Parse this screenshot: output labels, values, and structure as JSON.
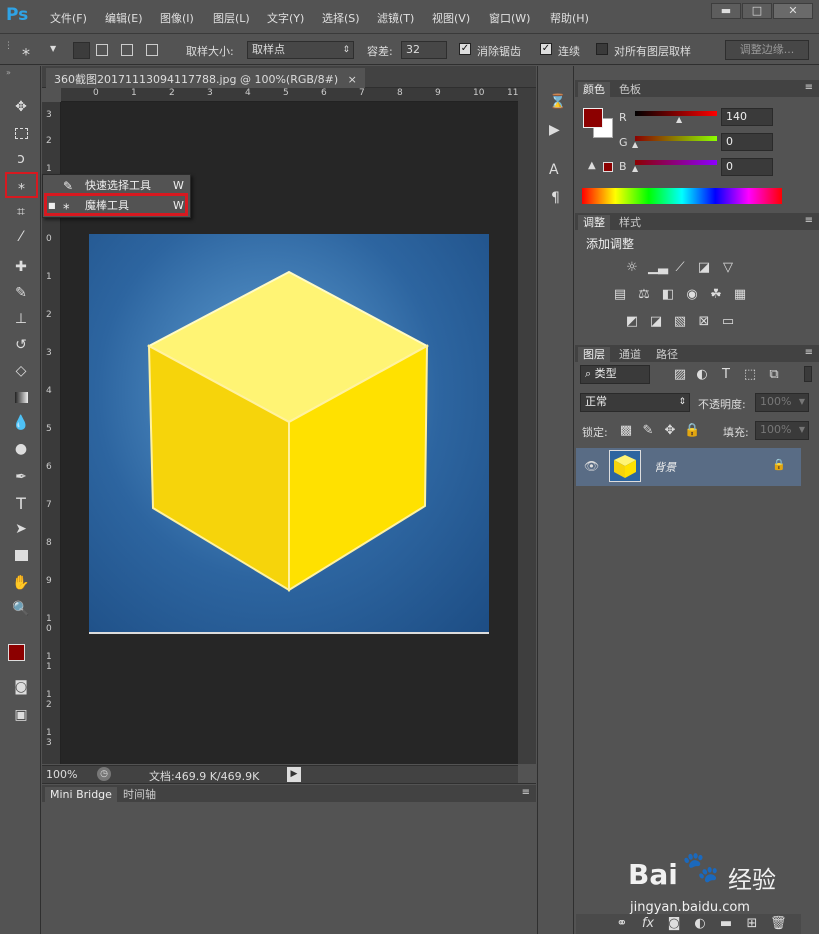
{
  "app": {
    "logo": "Ps"
  },
  "menu": [
    "文件(F)",
    "编辑(E)",
    "图像(I)",
    "图层(L)",
    "文字(Y)",
    "选择(S)",
    "滤镜(T)",
    "视图(V)",
    "窗口(W)",
    "帮助(H)"
  ],
  "window_controls": {
    "minimize": "▬",
    "maximize": "□",
    "close": "✕"
  },
  "options": {
    "sample_size_label": "取样大小:",
    "sample_size_value": "取样点",
    "tolerance_label": "容差:",
    "tolerance_value": "32",
    "antialias_label": "消除锯齿",
    "contiguous_label": "连续",
    "all_layers_label": "对所有图层取样",
    "refine_edge": "调整边缘..."
  },
  "document": {
    "tab_title": "360截图20171113094117788.jpg @ 100%(RGB/8#)",
    "close": "×",
    "zoom": "100%",
    "doc_size": "文档:469.9 K/469.9K",
    "ruler_top": [
      "0",
      "1",
      "2",
      "3",
      "4",
      "5",
      "6",
      "7",
      "8",
      "9",
      "10",
      "11"
    ],
    "ruler_left": [
      "3",
      "2",
      "1",
      "0",
      "1",
      "2",
      "3",
      "4",
      "5",
      "6",
      "7",
      "8",
      "9",
      "1",
      "0",
      "1",
      "1",
      "1",
      "2",
      "1",
      "3"
    ]
  },
  "flyout": {
    "items": [
      {
        "label": "快速选择工具",
        "shortcut": "W"
      },
      {
        "label": "魔棒工具",
        "shortcut": "W"
      }
    ]
  },
  "bottom_panel": {
    "tabs": [
      "Mini Bridge",
      "时间轴"
    ]
  },
  "color_panel": {
    "tabs": [
      "颜色",
      "色板"
    ],
    "r_label": "R",
    "g_label": "G",
    "b_label": "B",
    "r_value": "140",
    "g_value": "0",
    "b_value": "0",
    "fg_color": "#8c0000",
    "bg_color": "#ffffff"
  },
  "adjust_panel": {
    "tabs": [
      "调整",
      "样式"
    ],
    "title": "添加调整"
  },
  "layers_panel": {
    "tabs": [
      "图层",
      "通道",
      "路径"
    ],
    "filter_kind": "类型",
    "blend_mode": "正常",
    "opacity_label": "不透明度:",
    "opacity_value": "100%",
    "lock_label": "锁定:",
    "fill_label": "填充:",
    "fill_value": "100%",
    "layer_name": "背景"
  },
  "watermark": {
    "brand": "Bai",
    "brand2": "经验",
    "url": "jingyan.baidu.com"
  },
  "colors": {
    "accent": "#2fa3e6",
    "highlight_box": "#d71920",
    "cube_light": "#fff474",
    "cube_mid": "#ffe100",
    "cube_dark": "#e6b800"
  }
}
